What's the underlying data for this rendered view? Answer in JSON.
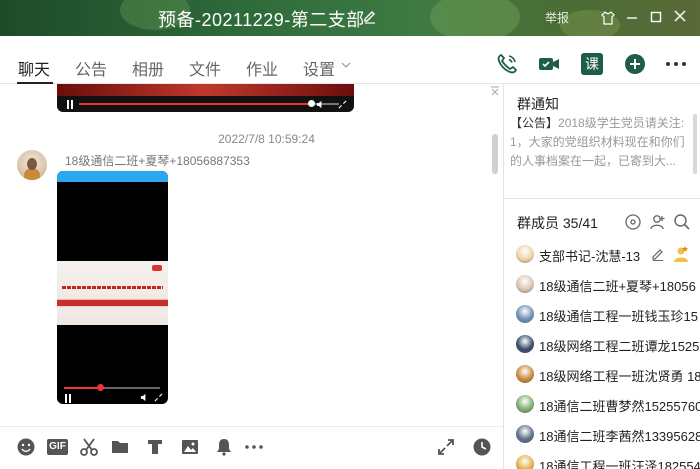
{
  "window": {
    "title": "预备-20211229-第二支部",
    "report_label": "举报"
  },
  "tabs": [
    {
      "label": "聊天",
      "active": true
    },
    {
      "label": "公告"
    },
    {
      "label": "相册"
    },
    {
      "label": "文件"
    },
    {
      "label": "作业"
    },
    {
      "label": "设置"
    }
  ],
  "toolbar_icons": [
    "phone-call-icon",
    "video-call-icon",
    "class-icon",
    "add-icon",
    "more-icon"
  ],
  "toolbar": {
    "class_label": "课"
  },
  "chat": {
    "timestamp": "2022/7/8 10:59:24",
    "sender": "18级通信二班+夏琴+18056887353"
  },
  "input_toolbar": {
    "gif_label": "GIF",
    "icons": [
      "emoji-icon",
      "gif-icon",
      "scissors-icon",
      "folder-icon",
      "doc-icon",
      "image-icon",
      "bell-icon",
      "more-icon",
      "expand-icon",
      "history-icon"
    ]
  },
  "notice": {
    "title": "群通知",
    "tag": "【公告】",
    "line1": "2018级学生党员请关注:",
    "line2": "1，大家的党组织材料现在和你们的人事档案在一起，已寄到大..."
  },
  "members": {
    "title": "群成员 35/41",
    "list": [
      {
        "name": "支部书记-沈慧-13",
        "color": "#f3d3a8"
      },
      {
        "name": "18级通信二班+夏琴+18056",
        "color": "#d9c6ae"
      },
      {
        "name": "18级通信工程一班钱玉珍15",
        "color": "#6e8fb3"
      },
      {
        "name": "18级网络工程二班谭龙1525",
        "color": "#3a4c6a"
      },
      {
        "name": "18级网络工程一班沈贤勇 18",
        "color": "#c98a3d"
      },
      {
        "name": "18通信二班曹梦然15255760",
        "color": "#7fae6d"
      },
      {
        "name": "18通信二班李茜然13395628",
        "color": "#5d6f88"
      },
      {
        "name": "18通信工程一班汪泽182554",
        "color": "#e0b34a"
      }
    ]
  },
  "colors": {
    "accent_green": "#2e6b3a",
    "icon_green": "#1f5e45"
  }
}
